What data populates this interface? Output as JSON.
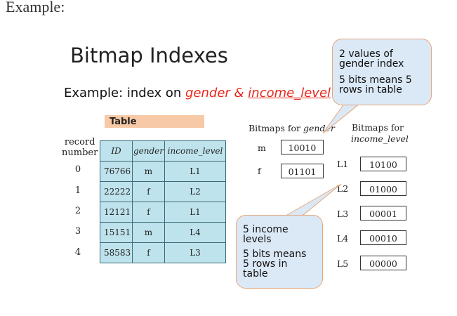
{
  "heading": "Example:",
  "slide": {
    "title": "Bitmap Indexes",
    "subtitle_prefix": "Example: index on ",
    "subtitle_gender": "gender",
    "subtitle_amp": " & ",
    "subtitle_income": "income_level"
  },
  "table": {
    "tag": "Table",
    "record_label_1": "record",
    "record_label_2": "number",
    "headers": [
      "ID",
      "gender",
      "income_level"
    ],
    "record_numbers": [
      "0",
      "1",
      "2",
      "3",
      "4"
    ],
    "rows": [
      [
        "76766",
        "m",
        "L1"
      ],
      [
        "22222",
        "f",
        "L2"
      ],
      [
        "12121",
        "f",
        "L1"
      ],
      [
        "15151",
        "m",
        "L4"
      ],
      [
        "58583",
        "f",
        "L3"
      ]
    ]
  },
  "gender_bitmaps": {
    "label_prefix": "Bitmaps for ",
    "label_italic": "gender",
    "rows": [
      {
        "key": "m",
        "bits": "10010"
      },
      {
        "key": "f",
        "bits": "01101"
      }
    ]
  },
  "income_bitmaps": {
    "label_line1": "Bitmaps for",
    "label_line2": "income_level",
    "rows": [
      {
        "key": "L1",
        "bits": "10100"
      },
      {
        "key": "L2",
        "bits": "01000"
      },
      {
        "key": "L3",
        "bits": "00001"
      },
      {
        "key": "L4",
        "bits": "00010"
      },
      {
        "key": "L5",
        "bits": "00000"
      }
    ]
  },
  "callouts": {
    "top": [
      "2 values of",
      "gender index",
      "",
      "5 bits means 5",
      "rows in table"
    ],
    "bottom": [
      "5 income",
      "levels",
      "",
      "5 bits means",
      "5 rows in",
      "table"
    ]
  },
  "colors": {
    "table_fill": "#bfe3ec",
    "tag_fill": "#f7c9a6",
    "callout_fill": "#dbe8f6",
    "callout_border": "#e6a87a",
    "accent_red": "#e8281e"
  }
}
